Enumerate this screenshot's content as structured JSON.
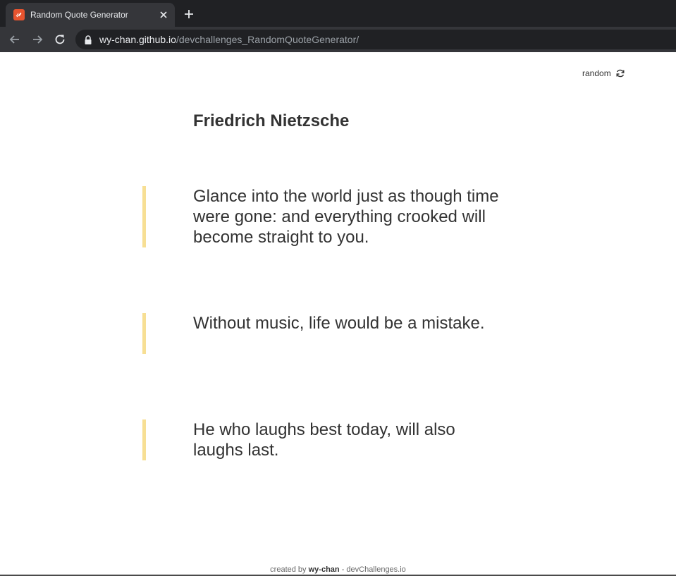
{
  "browser": {
    "tab_title": "Random Quote Generator",
    "url_host": "wy-chan.github.io",
    "url_path": "/devchallenges_RandomQuoteGenerator/"
  },
  "page": {
    "random_label": "random",
    "author": "Friedrich Nietzsche",
    "quotes": [
      "Glance into the world just as though time were gone: and everything crooked will become straight to you.",
      "Without music, life would be a mistake.",
      "He who laughs best today, will also laughs last."
    ],
    "footer": {
      "prefix": "created by",
      "author": "wy-chan",
      "suffix": "- devChallenges.io"
    }
  },
  "colors": {
    "quote_accent": "#f7df94",
    "favicon": "#e8542f",
    "text": "#333333"
  }
}
